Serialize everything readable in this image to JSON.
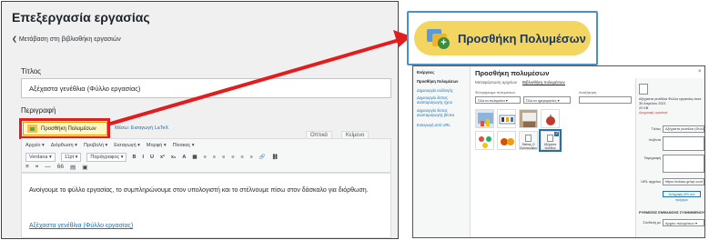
{
  "left": {
    "title": "Επεξεργασία εργασίας",
    "back_link": "Μετάβαση στη βιβλιοθήκη εργασιών",
    "title_label": "Τίτλος",
    "title_value": "Αξέχαστα γενέθλια (Φύλλο εργασίας)",
    "description_label": "Περιγραφή",
    "add_media_label": "Προσθήκη Πολυμέσων",
    "latex_link": "Μέσω: Εισαγωγή LaTeX",
    "tabs": [
      "Οπτικά",
      "Κείμενο"
    ],
    "menu": [
      "Αρχείο ▾",
      "Διόρθωση ▾",
      "Προβολή ▾",
      "Εισαγωγή ▾",
      "Μορφή ▾",
      "Πίνακας ▾"
    ],
    "font_family": "Verdana",
    "font_size": "11pt",
    "paragraph": "Παράγραφος",
    "format_icons": [
      "B",
      "I",
      "U",
      "̶S",
      "x²",
      "x₂",
      "A",
      "▦",
      "≡",
      "≡",
      "≡",
      "≡",
      "≡",
      "≡",
      "🔗",
      "⛓"
    ],
    "row3_icons": [
      "≡",
      "❝",
      "―",
      "66",
      "▤",
      "▣"
    ],
    "body_text": "Ανοίγουμε το φύλλο εργασίας, το συμπληρώνουμε στον υπολογιστή και το στέλνουμε πίσω στον δάσκαλο για διόρθωση.",
    "doc_link": "Αξέχαστα γενέθλια (Φύλλο εργασίας)"
  },
  "zoom": {
    "label": "Προσθήκη Πολυμέσων"
  },
  "dialog": {
    "sidebar_header": "Ενέργειες",
    "sidebar_items": [
      "Προσθήκη πολυμέσων",
      "Δημιουργία συλλογής",
      "Δημιουργία λίστας αναπαραγωγής ήχου",
      "Δημιουργία λίστας αναπαραγωγής βίντεο",
      "Εισαγωγή από URL"
    ],
    "title": "Προσθήκη πολυμέσων",
    "close": "×",
    "tabs": [
      "Μεταφόρτωση αρχείων",
      "Βιβλιοθήκη πολυμέσων"
    ],
    "filter_label": "Φιλτράρισμα πολυμέσων",
    "filter_type": "Όλα τα πολυμέσα",
    "filter_date": "Όλα τα ημερομηνίες",
    "search_label": "Αναζήτηση",
    "doc_tiles": [
      "Sfalma_D Giannoulatou_D ergasia 2a_ed_808-415.pdf",
      "Αξέχαστα γενέθλια Φύλλο εργασίας.docx"
    ],
    "details": {
      "filename": "Αξέχαστα γενέθλια Φύλλο εργασίας.docx",
      "date": "30 Απριλίου 2021",
      "size": "22 KB",
      "delete": "Διαγραφή οριστικά",
      "fields": [
        {
          "label": "Τίτλος",
          "value": "Αξέχαστα γενέθλια (Φύλλ"
        },
        {
          "label": "Λεζάντα",
          "value": ""
        },
        {
          "label": "Περιγραφή",
          "value": ""
        },
        {
          "label": "URL αρχείου",
          "value": "https://eclass.gr/wp-cont"
        }
      ],
      "copy_button": "Αντιγραφή URL στο πρόχειρο",
      "settings_header": "ΡΥΘΜΙΣΕΙΣ ΕΜΦΑΝΙΣΗΣ ΣΥΝΗΜΜΕΝΟΥ",
      "link_label": "Σύνδεση με",
      "link_value": "Αρχείο πολυμέσων"
    }
  },
  "colors": {
    "highlight_red": "#e21d1d",
    "accent_blue": "#2271b1",
    "button_yellow": "#f3d562"
  }
}
